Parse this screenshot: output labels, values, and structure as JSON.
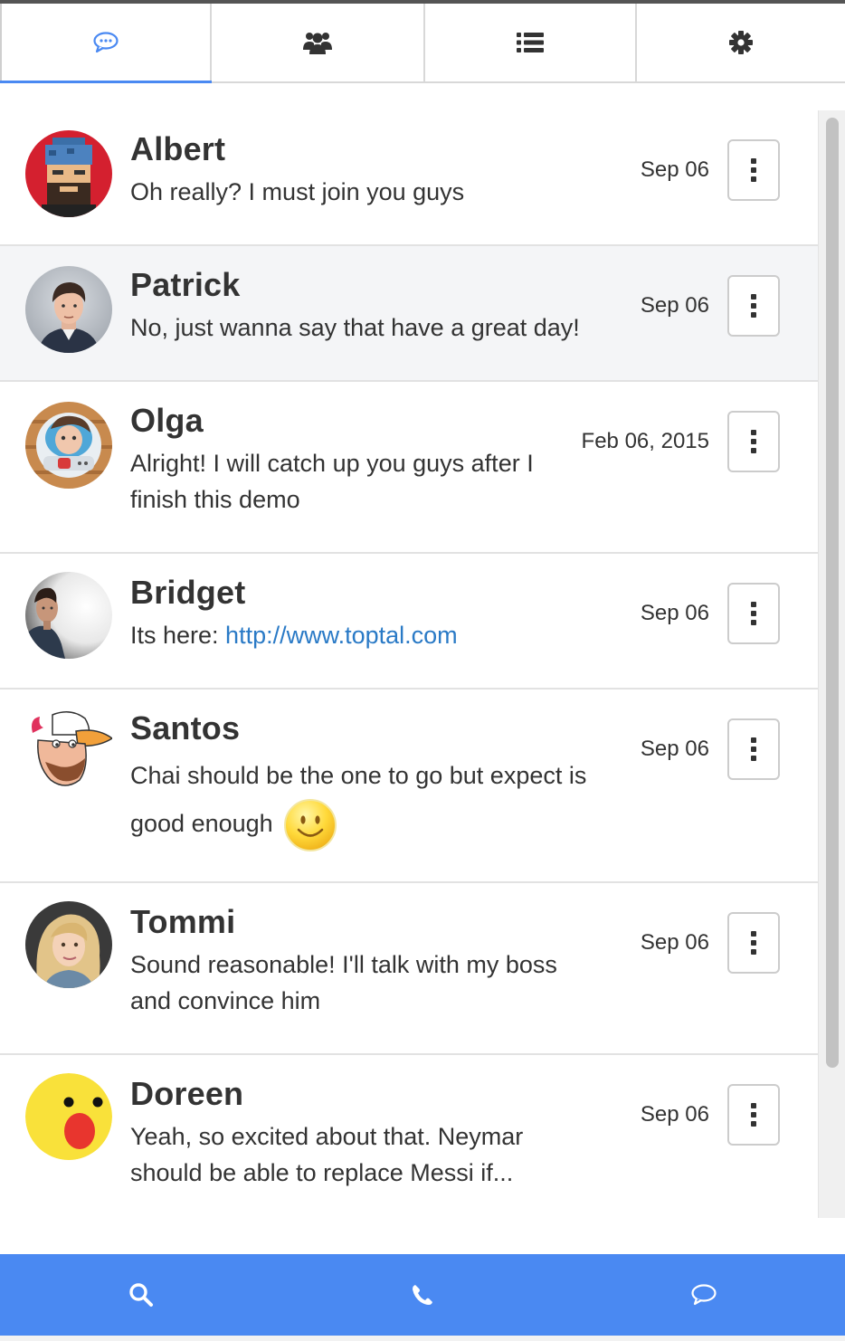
{
  "tabs": [
    {
      "icon": "chat-icon",
      "active": true
    },
    {
      "icon": "users-icon",
      "active": false
    },
    {
      "icon": "list-icon",
      "active": false
    },
    {
      "icon": "gear-icon",
      "active": false
    }
  ],
  "colors": {
    "accent": "#4a89f2",
    "link": "#2a7ac6",
    "text": "#333333",
    "hover_row": "#f4f5f7"
  },
  "conversations": [
    {
      "name": "Albert",
      "message": "Oh really? I must join you guys",
      "date": "Sep 06",
      "avatar": "pixel-art-avatar"
    },
    {
      "name": "Patrick",
      "message": "No, just wanna say that have a great day!",
      "date": "Sep 06",
      "avatar": "man-photo-avatar"
    },
    {
      "name": "Olga",
      "message": "Alright! I will catch up you guys after I finish this demo",
      "date": "Feb 06, 2015",
      "avatar": "astronaut-avatar"
    },
    {
      "name": "Bridget",
      "message_prefix": "Its here: ",
      "link": "http://www.toptal.com",
      "date": "Sep 06",
      "avatar": "sketch-avatar"
    },
    {
      "name": "Santos",
      "message": "Chai should be the one to go but expect is good enough",
      "emoji": "smiley-emoji",
      "date": "Sep 06",
      "avatar": "duck-cartoon-avatar"
    },
    {
      "name": "Tommi",
      "message": "Sound reasonable! I'll talk with my boss and convince him",
      "date": "Sep 06",
      "avatar": "woman-photo-avatar"
    },
    {
      "name": "Doreen",
      "message": "Yeah, so excited about that. Neymar should be able to replace Messi if...",
      "date": "Sep 06",
      "avatar": "surprised-face-avatar"
    }
  ],
  "bottom_bar": [
    {
      "icon": "search-icon"
    },
    {
      "icon": "phone-icon"
    },
    {
      "icon": "comment-icon"
    }
  ]
}
